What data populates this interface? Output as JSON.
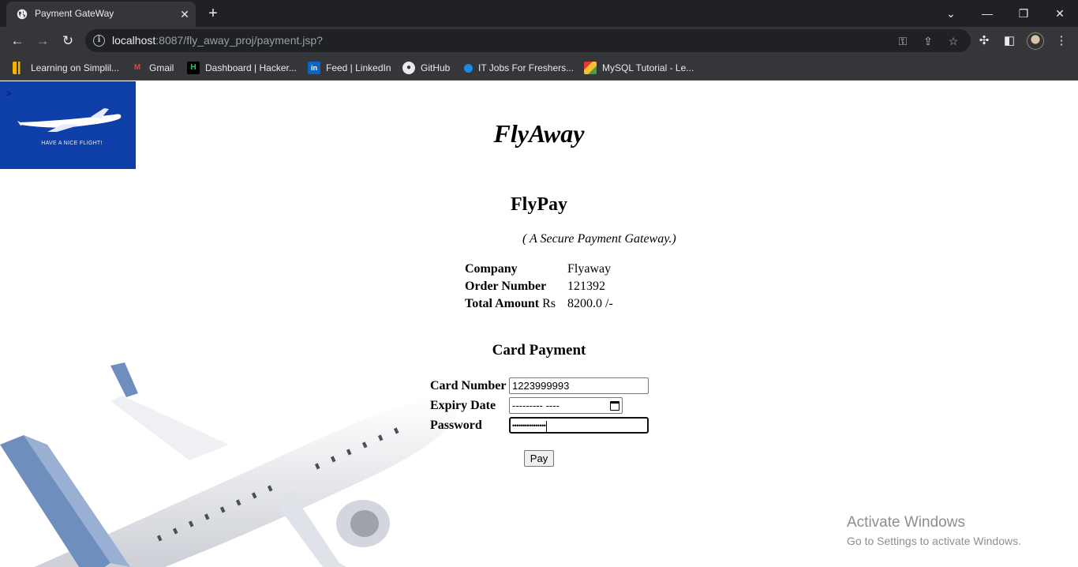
{
  "browser": {
    "tab_title": "Payment GateWay",
    "url_host": "localhost",
    "url_rest": ":8087/fly_away_proj/payment.jsp?",
    "bookmarks": [
      {
        "label": "Learning on Simplil...",
        "icon": "simplilearn-icon",
        "color": "#f4b400"
      },
      {
        "label": "Gmail",
        "icon": "gmail-icon",
        "color": "#ea4335"
      },
      {
        "label": "Dashboard | Hacker...",
        "icon": "hackerrank-icon",
        "color": "#2ec866"
      },
      {
        "label": "Feed | LinkedIn",
        "icon": "linkedin-icon",
        "color": "#0a66c2"
      },
      {
        "label": "GitHub",
        "icon": "github-icon",
        "color": "#ffffff"
      },
      {
        "label": "IT Jobs For Freshers...",
        "icon": "itjobs-icon",
        "color": "#1e88e5"
      },
      {
        "label": "MySQL Tutorial - Le...",
        "icon": "mysql-tutorial-icon",
        "color": "#e53935"
      }
    ]
  },
  "page": {
    "logo_caret": ">",
    "logo_tagline": "HAVE A NICE FLIGHT!",
    "brand": "FlyAway",
    "title": "FlyPay",
    "tagline": "( A Secure Payment Gateway.)",
    "info": {
      "company_label": "Company",
      "company_value": "Flyaway",
      "order_label": "Order Number",
      "order_value": "121392",
      "amount_label": "Total Amount",
      "amount_unit": "Rs",
      "amount_value": "8200.0 /-"
    },
    "card_title": "Card Payment",
    "form": {
      "card_number_label": "Card Number",
      "card_number_value": "1223999993",
      "expiry_label": "Expiry Date",
      "expiry_value": "--------- ----",
      "password_label": "Password",
      "password_value": "••••••••••••••••",
      "pay_label": "Pay"
    }
  },
  "watermark": {
    "title": "Activate Windows",
    "subtitle": "Go to Settings to activate Windows."
  }
}
